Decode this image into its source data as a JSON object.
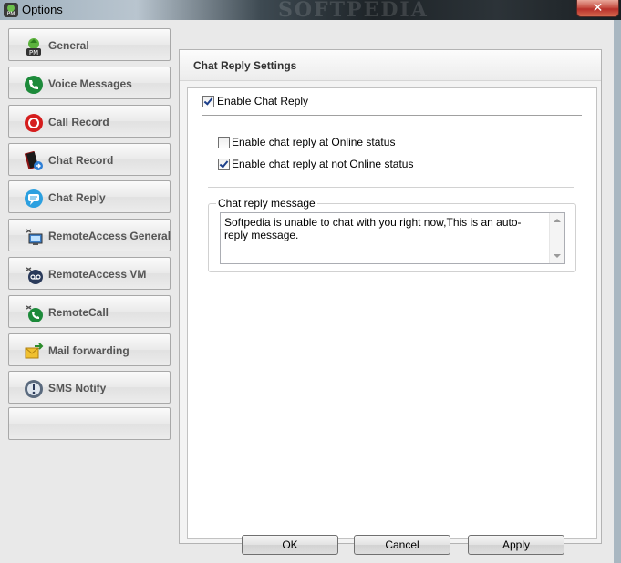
{
  "window": {
    "title": "Options",
    "watermark": "SOFTPEDIA",
    "close_label": "✕"
  },
  "sidebar": {
    "items": [
      {
        "label": "General",
        "icon": "pm-logo-icon"
      },
      {
        "label": "Voice Messages",
        "icon": "phone-icon"
      },
      {
        "label": "Call Record",
        "icon": "record-icon"
      },
      {
        "label": "Chat Record",
        "icon": "book-icon"
      },
      {
        "label": "Chat Reply",
        "icon": "chat-bubble-icon"
      },
      {
        "label": "RemoteAccess General",
        "icon": "remote-computer-icon"
      },
      {
        "label": "RemoteAccess VM",
        "icon": "remote-voicemail-icon"
      },
      {
        "label": "RemoteCall",
        "icon": "remote-call-icon"
      },
      {
        "label": "Mail forwarding",
        "icon": "mail-forward-icon"
      },
      {
        "label": "SMS Notify",
        "icon": "sms-icon"
      },
      {
        "label": "",
        "icon": ""
      }
    ]
  },
  "panel": {
    "title": "Chat Reply Settings",
    "enable_chat_reply": {
      "label": "Enable Chat Reply",
      "checked": true
    },
    "online_status": {
      "label": "Enable chat reply at Online status",
      "checked": false
    },
    "not_online_status": {
      "label": "Enable chat reply at not Online status",
      "checked": true
    },
    "message_group_label": "Chat reply message",
    "message_text": "Softpedia is unable to chat with you right now,This is an auto-reply message."
  },
  "buttons": {
    "ok": "OK",
    "cancel": "Cancel",
    "apply": "Apply"
  },
  "colors": {
    "accent_check": "#1c3f8a",
    "sidebar_text": "#555555"
  }
}
